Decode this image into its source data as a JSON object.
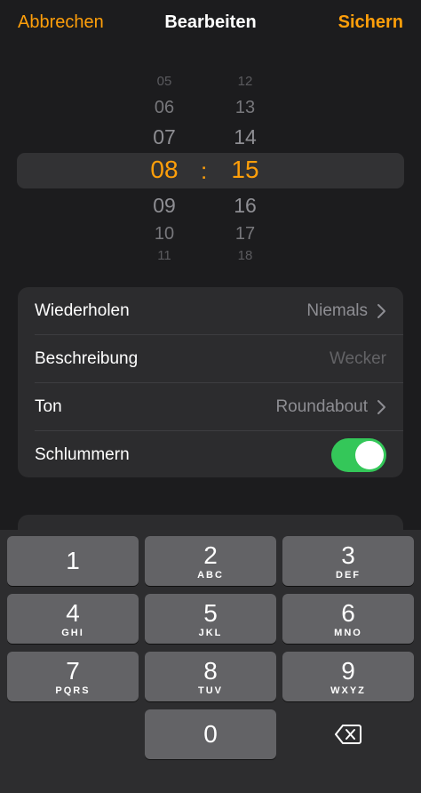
{
  "nav": {
    "cancel_label": "Abbrechen",
    "title": "Bearbeiten",
    "save_label": "Sichern"
  },
  "picker": {
    "hours": [
      "05",
      "06",
      "07",
      "08",
      "09",
      "10",
      "11"
    ],
    "minutes": [
      "12",
      "13",
      "14",
      "15",
      "16",
      "17",
      "18"
    ],
    "selected_hour": "08",
    "selected_minute": "15",
    "separator": ":"
  },
  "settings": {
    "repeat": {
      "label": "Wiederholen",
      "value": "Niemals"
    },
    "description": {
      "label": "Beschreibung",
      "placeholder": "Wecker"
    },
    "sound": {
      "label": "Ton",
      "value": "Roundabout"
    },
    "snooze": {
      "label": "Schlummern",
      "enabled": true
    }
  },
  "keypad": {
    "keys": [
      {
        "digit": "1",
        "letters": ""
      },
      {
        "digit": "2",
        "letters": "ABC"
      },
      {
        "digit": "3",
        "letters": "DEF"
      },
      {
        "digit": "4",
        "letters": "GHI"
      },
      {
        "digit": "5",
        "letters": "JKL"
      },
      {
        "digit": "6",
        "letters": "MNO"
      },
      {
        "digit": "7",
        "letters": "PQRS"
      },
      {
        "digit": "8",
        "letters": "TUV"
      },
      {
        "digit": "9",
        "letters": "WXYZ"
      },
      {
        "digit": "0",
        "letters": ""
      }
    ],
    "delete_icon": "delete-backspace-icon"
  },
  "colors": {
    "accent": "#ff9f0a",
    "toggle_on": "#34c759",
    "background": "#1c1c1e",
    "group": "#2c2c2e",
    "key": "#636366"
  }
}
